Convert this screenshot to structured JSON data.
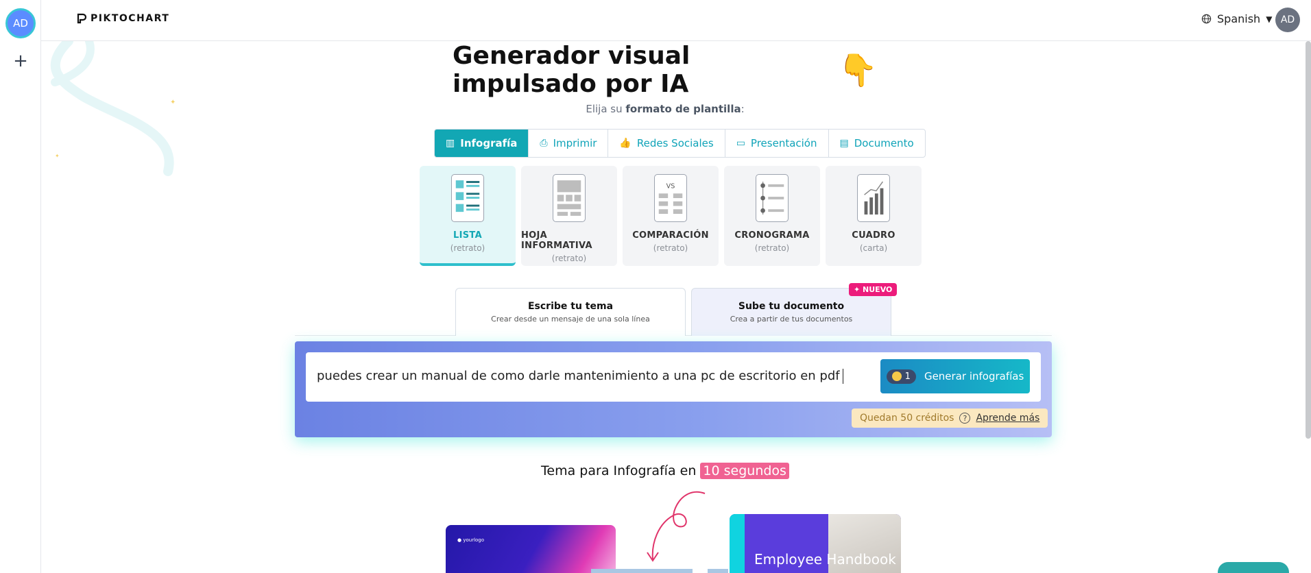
{
  "rail": {
    "avatar_initials": "AD",
    "add_icon": "plus-icon"
  },
  "topbar": {
    "logo_text": "PIKTOCHART",
    "language": "Spanish",
    "avatar_initials": "AD"
  },
  "hero": {
    "title": "Generador visual impulsado por IA",
    "emoji": "👇",
    "subtitle_prefix": "Elija su ",
    "subtitle_bold": "formato de plantilla",
    "subtitle_suffix": ":"
  },
  "format_tabs": [
    {
      "label": "Infografía",
      "icon": "infographic-icon",
      "glyph": "▥",
      "active": true
    },
    {
      "label": "Imprimir",
      "icon": "print-icon",
      "glyph": "⎙",
      "active": false
    },
    {
      "label": "Redes Sociales",
      "icon": "thumbs-up-icon",
      "glyph": "👍",
      "active": false
    },
    {
      "label": "Presentación",
      "icon": "presentation-icon",
      "glyph": "▭",
      "active": false
    },
    {
      "label": "Documento",
      "icon": "document-icon",
      "glyph": "▤",
      "active": false
    }
  ],
  "template_cards": [
    {
      "name": "LISTA",
      "sub": "(retrato)",
      "active": true
    },
    {
      "name": "HOJA INFORMATIVA",
      "sub": "(retrato)",
      "active": false
    },
    {
      "name": "COMPARACIÓN",
      "sub": "(retrato)",
      "active": false,
      "thumb_label": "VS"
    },
    {
      "name": "CRONOGRAMA",
      "sub": "(retrato)",
      "active": false
    },
    {
      "name": "CUADRO",
      "sub": "(carta)",
      "active": false
    }
  ],
  "source_tabs": [
    {
      "title": "Escribe tu tema",
      "subtitle": "Crear desde un mensaje de una sola línea",
      "active": true
    },
    {
      "title": "Sube tu documento",
      "subtitle": "Crea a partir de tus documentos",
      "active": false,
      "badge": "NUEVO"
    }
  ],
  "prompt": {
    "value": "puedes crear un manual de como darle mantenimiento a una pc de escritorio en pdf",
    "generate_label": "Generar infografías",
    "credit_cost": "1",
    "credits_text": "Quedan 50 créditos",
    "learn_more": "Aprende más"
  },
  "bottom": {
    "tema_prefix": "Tema para Infografía en ",
    "tema_highlight": "10 segundos",
    "preview_left_logo": "yourlogo",
    "preview_right_title": "Employee Handbook"
  },
  "colors": {
    "accent": "#12a7b4",
    "badge": "#ec1c7b",
    "credits_bg": "#fbe8c0",
    "panel_start": "#6b82e3",
    "panel_end": "#b6bff5"
  }
}
